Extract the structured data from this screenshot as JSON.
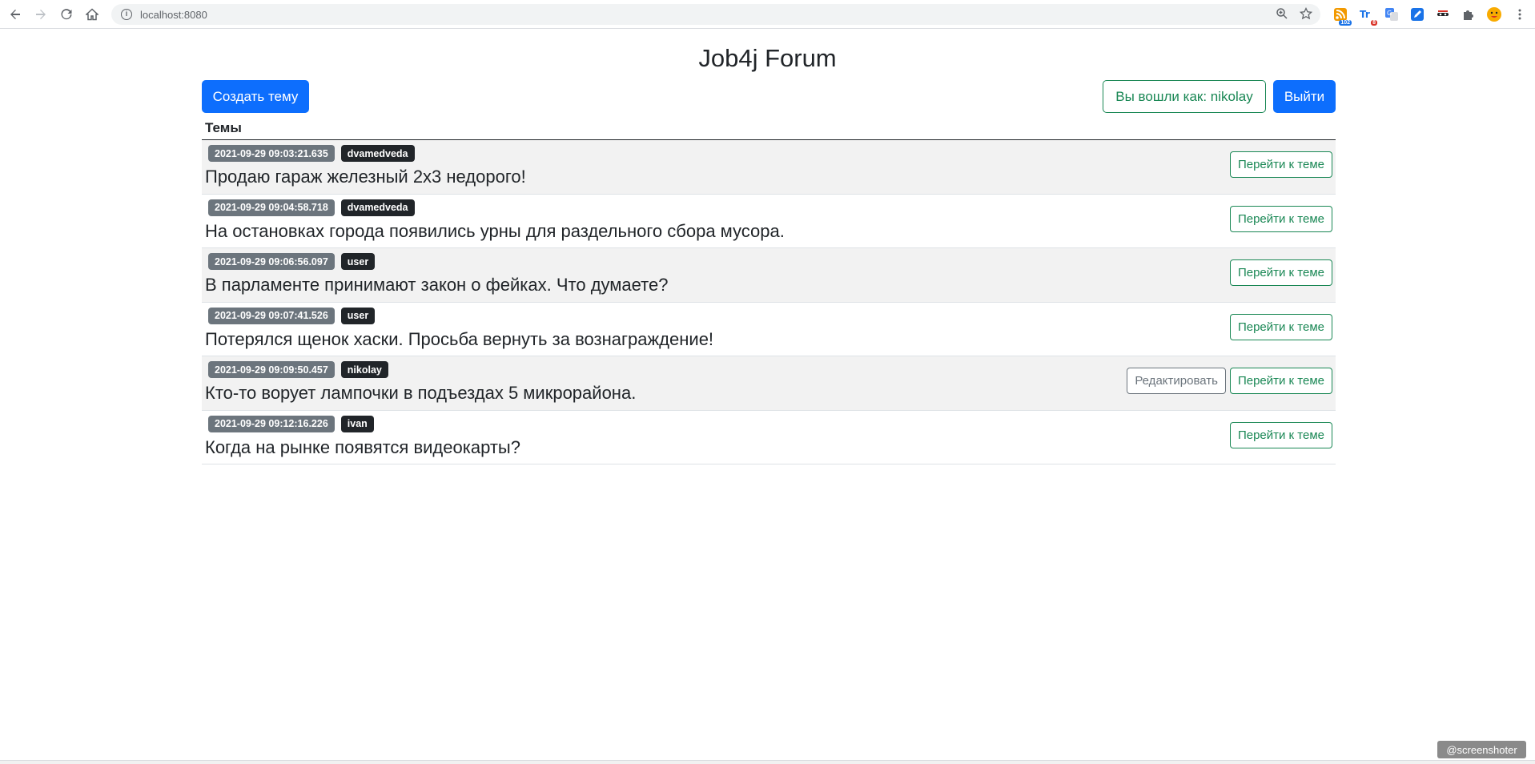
{
  "browser": {
    "url": "localhost:8080",
    "extensions": [
      {
        "icon": "rss-feed-icon",
        "badge": "102",
        "badge_color": "#1a73e8"
      },
      {
        "icon": "translate-icon",
        "badge": "8",
        "badge_color": "#d93025"
      },
      {
        "icon": "google-translate-icon",
        "badge": "",
        "badge_color": ""
      },
      {
        "icon": "edit-extension-icon",
        "badge": "",
        "badge_color": ""
      },
      {
        "icon": "incognito-icon",
        "badge": "",
        "badge_color": ""
      },
      {
        "icon": "puzzle-icon",
        "badge": "",
        "badge_color": ""
      }
    ]
  },
  "page": {
    "title": "Job4j Forum",
    "create_label": "Создать тему",
    "user_label": "Вы вошли как: nikolay",
    "logout_label": "Выйти",
    "table_header": "Темы",
    "go_label": "Перейти к теме",
    "edit_label": "Редактировать"
  },
  "topics": [
    {
      "date": "2021-09-29 09:03:21.635",
      "author": "dvamedveda",
      "name": "Продаю гараж железный 2х3 недорого!",
      "editable": false
    },
    {
      "date": "2021-09-29 09:04:58.718",
      "author": "dvamedveda",
      "name": "На остановках города появились урны для раздельного сбора мусора.",
      "editable": false
    },
    {
      "date": "2021-09-29 09:06:56.097",
      "author": "user",
      "name": "В парламенте принимают закон о фейках. Что думаете?",
      "editable": false
    },
    {
      "date": "2021-09-29 09:07:41.526",
      "author": "user",
      "name": "Потерялся щенок хаски. Просьба вернуть за вознаграждение!",
      "editable": false
    },
    {
      "date": "2021-09-29 09:09:50.457",
      "author": "nikolay",
      "name": "Кто-то ворует лампочки в подъездах 5 микрорайона.",
      "editable": true
    },
    {
      "date": "2021-09-29 09:12:16.226",
      "author": "ivan",
      "name": "Когда на рынке появятся видеокарты?",
      "editable": false
    }
  ],
  "watermark": "@screenshoter",
  "colors": {
    "primary": "#0d6efd",
    "success": "#198754",
    "secondary": "#6c757d",
    "dark": "#212529"
  }
}
